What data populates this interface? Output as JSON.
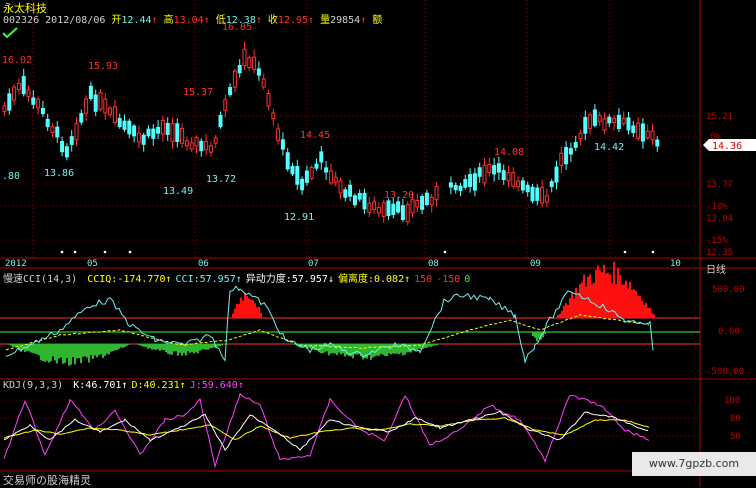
{
  "stock": {
    "name": "永太科技",
    "code": "002326",
    "date": "2012/08/06"
  },
  "quote": {
    "open_label": "开",
    "open": "12.44",
    "high_label": "高",
    "high": "13.04",
    "low_label": "低",
    "low": "12.38",
    "close_label": "收",
    "close": "12.95",
    "volume_label": "量",
    "volume": "29854",
    "amount_label": "额"
  },
  "price_labels": [
    {
      "text": "16.02",
      "color": "#ff3030"
    },
    {
      "text": "15.93",
      "color": "#ff3030"
    },
    {
      "text": "16.85",
      "color": "#ff3030"
    },
    {
      "text": "15.37",
      "color": "#ff3030"
    },
    {
      "text": "14.45",
      "color": "#ff3030"
    },
    {
      "text": "14.08",
      "color": "#ff3030"
    },
    {
      "text": "13.20",
      "color": "#ff3030"
    },
    {
      "text": ".80",
      "color": "#6ff0f0"
    },
    {
      "text": "13.86",
      "color": "#6ff0f0"
    },
    {
      "text": "13.49",
      "color": "#6ff0f0"
    },
    {
      "text": "13.72",
      "color": "#6ff0f0"
    },
    {
      "text": "12.91",
      "color": "#6ff0f0"
    },
    {
      "text": "14.42",
      "color": "#6ff0f0"
    }
  ],
  "right_axis": [
    "15.21",
    "0%",
    "13.77",
    "-10%",
    "13.04",
    "-15%",
    "12.35"
  ],
  "current_price": "14.36",
  "x_axis": [
    "2012",
    "05",
    "06",
    "07",
    "08",
    "09",
    "10"
  ],
  "period": "日线",
  "indicator": {
    "name": "慢速CCI(14,3)",
    "items": [
      {
        "label": "CCIQ:",
        "value": "-174.770",
        "arrow": "↑",
        "color": "#ffff00"
      },
      {
        "label": "CCI:",
        "value": "57.957",
        "arrow": "↑",
        "color": "#6ff0f0"
      },
      {
        "label": "异动力度:",
        "value": "57.957",
        "arrow": "↓",
        "color": "#ffffff"
      },
      {
        "label": "偏离度:",
        "value": "0.082",
        "arrow": "↑",
        "color": "#ffff00"
      },
      {
        "label": "",
        "value": "150",
        "arrow": "",
        "color": "#ff3030"
      },
      {
        "label": "",
        "value": "-150",
        "arrow": "",
        "color": "#ff3030"
      },
      {
        "label": "",
        "value": "0",
        "arrow": "",
        "color": "#30ff30"
      }
    ],
    "axis": [
      "500.00",
      "0.00",
      "-500.00"
    ]
  },
  "kdj": {
    "name": "KDJ(9,3,3)",
    "items": [
      {
        "label": "K:",
        "value": "46.701",
        "arrow": "↑",
        "color": "#ffffff"
      },
      {
        "label": "D:",
        "value": "40.231",
        "arrow": "↑",
        "color": "#ffff00"
      },
      {
        "label": "J:",
        "value": "59.640",
        "arrow": "↑",
        "color": "#ff40ff"
      }
    ],
    "axis": [
      "100",
      "80",
      "50"
    ]
  },
  "footer": "交易师の股海精灵",
  "watermark": "www.7gpzb.com",
  "colors": {
    "up": "#ff3030",
    "down": "#54ffff",
    "axis_red": "#b00000",
    "bg": "#000000"
  }
}
